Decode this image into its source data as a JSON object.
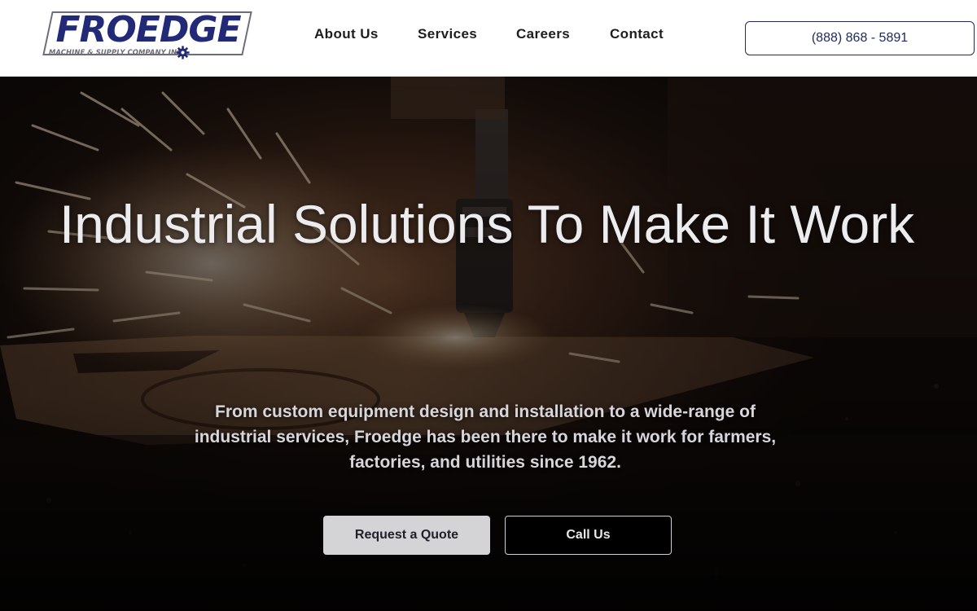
{
  "brand": {
    "name": "FROEDGE",
    "tagline": "MACHINE & SUPPLY COMPANY INC",
    "primary_color": "#222a78",
    "secondary_color": "#6c6c7a",
    "gear_icon": "gear-icon"
  },
  "nav": {
    "items": [
      {
        "label": "About Us"
      },
      {
        "label": "Services"
      },
      {
        "label": "Careers"
      },
      {
        "label": "Contact"
      }
    ]
  },
  "header": {
    "phone": "(888) 868 - 5891"
  },
  "hero": {
    "title": "Industrial Solutions To Make It Work",
    "description": "From custom equipment design and installation to a wide-range of industrial services, Froedge has been there to make it work for farmers, factories, and utilities since 1962.",
    "primary_cta": "Request a Quote",
    "secondary_cta": "Call Us",
    "background_image": "laser-cutting-sparks-photo"
  }
}
